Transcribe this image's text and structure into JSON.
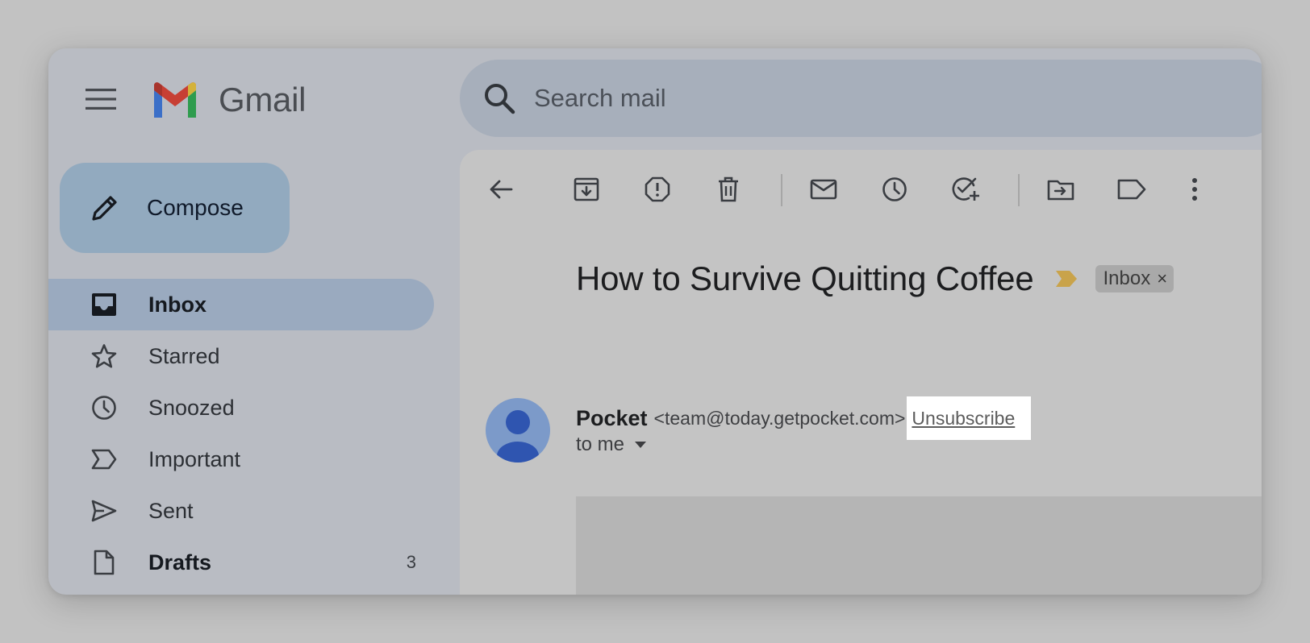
{
  "app": {
    "brand_name": "Gmail"
  },
  "search": {
    "placeholder": "Search mail"
  },
  "compose": {
    "label": "Compose"
  },
  "nav": [
    {
      "label": "Inbox",
      "icon": "inbox-icon",
      "active": true
    },
    {
      "label": "Starred",
      "icon": "star-icon"
    },
    {
      "label": "Snoozed",
      "icon": "clock-icon"
    },
    {
      "label": "Important",
      "icon": "important-icon"
    },
    {
      "label": "Sent",
      "icon": "send-icon"
    },
    {
      "label": "Drafts",
      "icon": "draft-icon",
      "count": "3"
    }
  ],
  "toolbar": [
    "back-icon",
    "archive-icon",
    "report-spam-icon",
    "delete-icon",
    "mark-unread-icon",
    "snooze-icon",
    "add-task-icon",
    "move-to-icon",
    "label-icon",
    "more-icon"
  ],
  "email": {
    "subject": "How to Survive Quitting Coffee",
    "label_chip": "Inbox",
    "chip_close": "×",
    "sender_name": "Pocket",
    "sender_email": "<team@today.getpocket.com>",
    "unsubscribe": "Unsubscribe",
    "recipient": "to me"
  },
  "colors": {
    "compose_bg": "#92aabf",
    "active_nav_bg": "#9aaabf",
    "important_marker": "#c9a34a",
    "avatar_bg": "#7c9ac9"
  }
}
